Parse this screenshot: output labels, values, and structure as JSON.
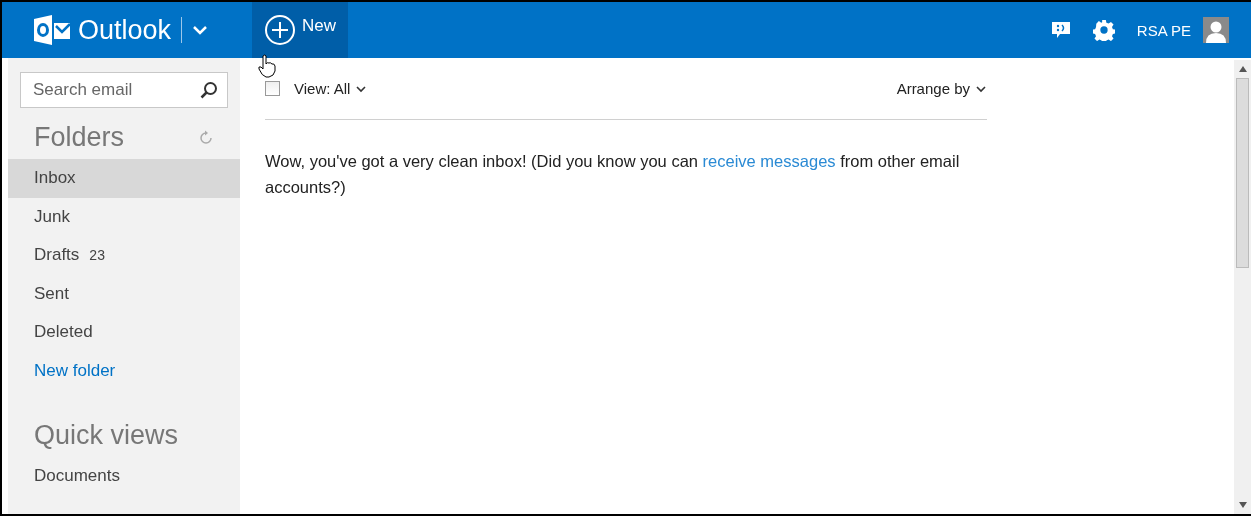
{
  "header": {
    "app_name": "Outlook",
    "new_button": "New",
    "user_name": "RSA PE"
  },
  "search": {
    "placeholder": "Search email"
  },
  "folders": {
    "title": "Folders",
    "items": [
      {
        "label": "Inbox",
        "selected": true
      },
      {
        "label": "Junk",
        "selected": false
      },
      {
        "label": "Drafts",
        "count": "23",
        "selected": false
      },
      {
        "label": "Sent",
        "selected": false
      },
      {
        "label": "Deleted",
        "selected": false
      }
    ],
    "new_folder": "New folder"
  },
  "quick_views": {
    "title": "Quick views",
    "items": [
      {
        "label": "Documents",
        "selected": false
      }
    ]
  },
  "toolbar": {
    "select_all_checked": false,
    "view": "View: All",
    "arrange": "Arrange by"
  },
  "message": {
    "before": "Wow, you've got a very clean inbox! (Did you know you can ",
    "link": "receive messages",
    "after": " from other email accounts?)"
  }
}
